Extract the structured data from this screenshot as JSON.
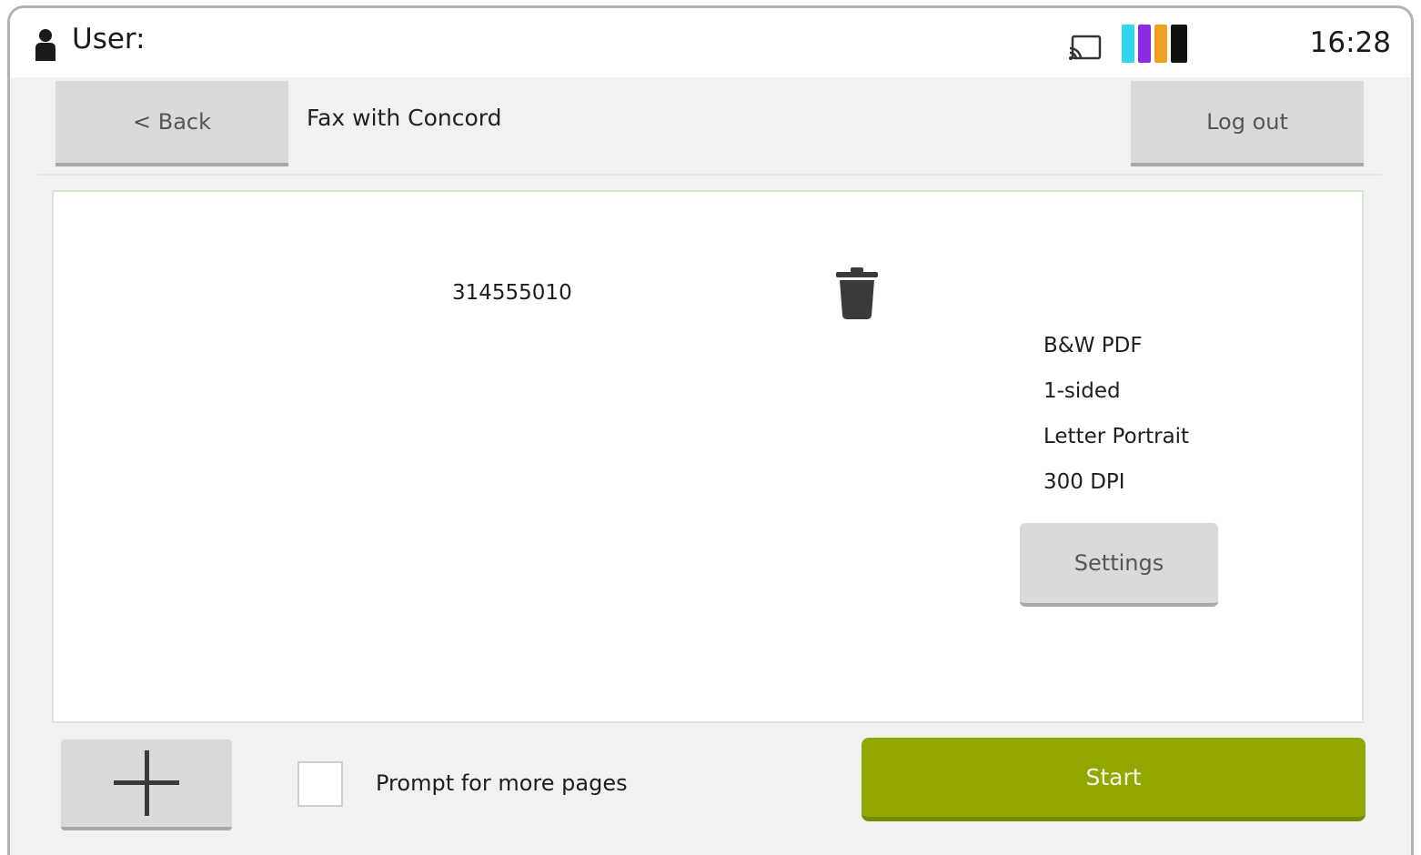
{
  "statusbar": {
    "user_label": "User:",
    "time": "16:28",
    "ink_colors": {
      "cyan": "#33d6f0",
      "magenta": "#8a2be2",
      "yellow": "#f0a020",
      "black": "#111111"
    }
  },
  "header": {
    "back_label": "< Back",
    "title": "Fax with Concord",
    "logout_label": "Log out"
  },
  "recipient": {
    "fax_number": "314555010"
  },
  "scan_options": [
    "B&W PDF",
    "1-sided",
    "Letter Portrait",
    "300 DPI"
  ],
  "settings_label": "Settings",
  "footer": {
    "prompt_label": "Prompt for more pages",
    "prompt_checked": false,
    "start_label": "Start",
    "start_color": "#93a600"
  }
}
